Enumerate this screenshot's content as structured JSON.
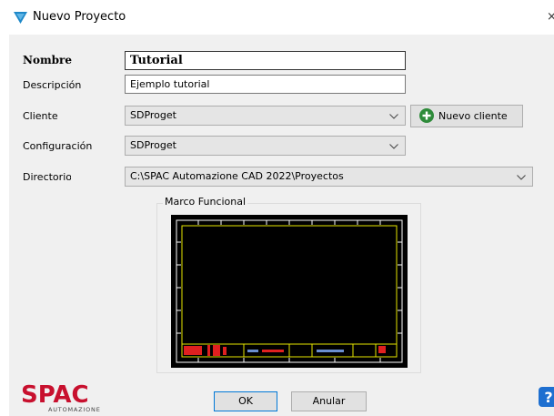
{
  "window": {
    "title": "Nuevo Proyecto",
    "close_glyph": "×"
  },
  "form": {
    "nombre": {
      "label": "Nombre",
      "value": "Tutorial"
    },
    "descripcion": {
      "label": "Descripción",
      "value": "Ejemplo tutorial"
    },
    "cliente": {
      "label": "Cliente",
      "selected": "SDProget"
    },
    "configuracion": {
      "label": "Configuración",
      "selected": "SDProget"
    },
    "directorio": {
      "label": "Directorio",
      "selected": "C:\\SPAC Automazione CAD 2022\\Proyectos"
    }
  },
  "buttons": {
    "nuevo_cliente": "Nuevo cliente",
    "ok": "OK",
    "anular": "Anular"
  },
  "preview": {
    "group_title": "Marco Funcional"
  },
  "logo": {
    "brand": "SPAC",
    "sub": "AUTOMAZIONE"
  },
  "icons": {
    "app": "app-triangle-icon",
    "add": "plus-circle-icon",
    "dropdown": "chevron-down-icon",
    "help": "help-icon"
  },
  "colors": {
    "app_icon": "#1e88c8",
    "add_icon": "#2e8b3a",
    "logo_red": "#c8102e",
    "accent_border": "#0078d7"
  }
}
